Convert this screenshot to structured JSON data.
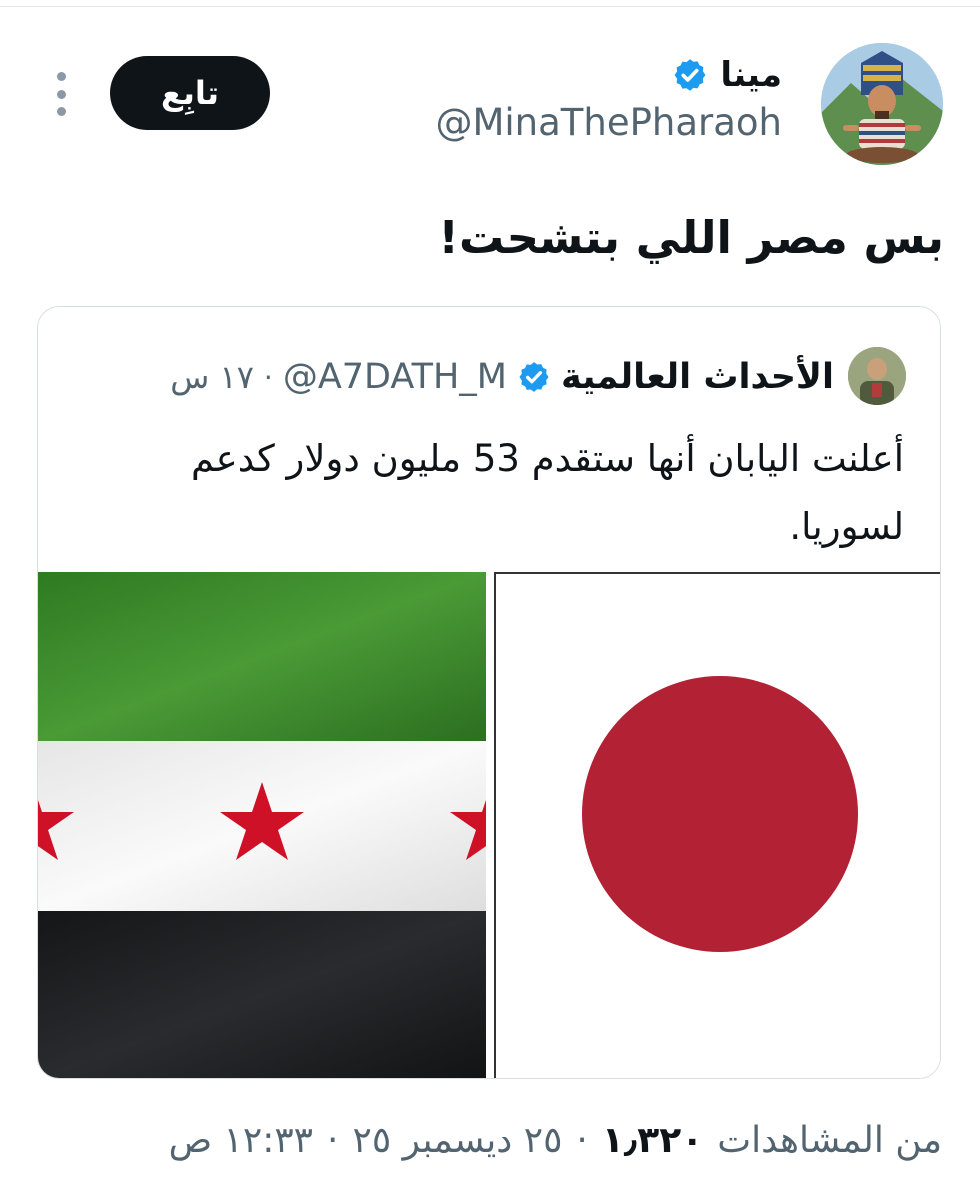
{
  "author": {
    "display_name": "مينا",
    "handle": "@MinaThePharaoh",
    "verified": true,
    "avatar": "pharaoh-cartoon-avatar"
  },
  "follow_button": {
    "label": "تابِع"
  },
  "more_menu": {
    "icon": "more-vertical-icon"
  },
  "tweet": {
    "text": "بس مصر اللي بتشحت!"
  },
  "quoted_tweet": {
    "author_name": "الأحداث العالمية",
    "handle": "@A7DATH_M",
    "separator": "·",
    "time": "١٧ س",
    "verified": true,
    "text": "أعلنت اليابان أنها ستقدم 53 مليون دولار كدعم لسوريا.",
    "media": [
      {
        "name": "syria-flag-image",
        "colors": [
          "#3b8a2b",
          "#f2f2f2",
          "#1f2022",
          "#ce1126"
        ]
      },
      {
        "name": "japan-flag-image",
        "colors": [
          "#ffffff",
          "#b22234"
        ]
      }
    ]
  },
  "meta": {
    "time": "١٢:٣٣ ص",
    "separator": "·",
    "date": "٢٥ ديسمبر ٢٥",
    "views_count": "١٫٣٢٠",
    "views_label": "من المشاهدات"
  },
  "colors": {
    "accent_verified": "#1d9bf0",
    "button_bg": "#0f1419",
    "secondary_text": "#536471"
  }
}
